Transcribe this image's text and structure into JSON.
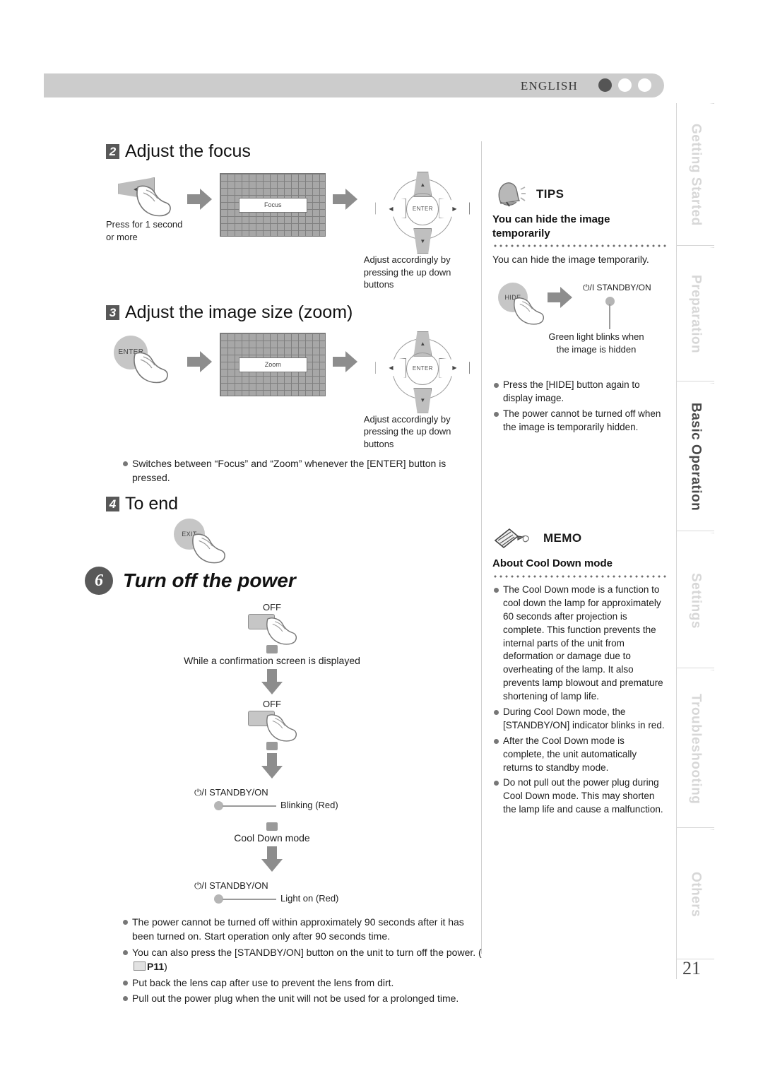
{
  "header": {
    "language": "ENGLISH",
    "dots": [
      "filled",
      "empty",
      "empty"
    ]
  },
  "sidebar": {
    "tabs": [
      {
        "label": "Getting Started",
        "active": false
      },
      {
        "label": "Preparation",
        "active": false
      },
      {
        "label": "Basic Operation",
        "active": true
      },
      {
        "label": "Settings",
        "active": false
      },
      {
        "label": "Troubleshooting",
        "active": false
      },
      {
        "label": "Others",
        "active": false
      }
    ],
    "page_number": "21"
  },
  "left": {
    "step2": {
      "number": "2",
      "title": "Adjust the focus",
      "press_caption_line1": "Press for 1 second",
      "press_caption_line2": "or more",
      "osd_label": "Focus",
      "dpad": {
        "center": "ENTER",
        "up": "▲",
        "down": "▼",
        "left": "◀",
        "right": "▶"
      },
      "adjust_caption_line1": "Adjust accordingly by",
      "adjust_caption_line2": "pressing the up down buttons"
    },
    "step3": {
      "number": "3",
      "title": "Adjust the image size (zoom)",
      "enter_key": "ENTER",
      "osd_label": "Zoom",
      "adjust_caption_line1": "Adjust accordingly by",
      "adjust_caption_line2": "pressing the up down buttons"
    },
    "switch_note": "Switches between “Focus” and “Zoom” whenever the [ENTER] button is pressed.",
    "step4": {
      "number": "4",
      "title": "To end",
      "exit_key": "EXIT"
    },
    "step6": {
      "number": "6",
      "title": "Turn off the power",
      "flow": {
        "off_label_1": "OFF",
        "confirm_text": "While a confirmation screen is displayed",
        "off_label_2": "OFF",
        "standby_label_1": "⏻/I  STANDBY/ON",
        "blinking_red": "Blinking (Red)",
        "cool_down_text": "Cool Down mode",
        "standby_label_2": "⏻/I  STANDBY/ON",
        "light_on_red": "Light on (Red)"
      },
      "bullets": [
        "The power cannot be turned off within approximately 90 seconds after it has been turned on. Start operation only after 90 seconds time.",
        "You can also press the [STANDBY/ON] button on the unit to turn off the power. (\u0001 P11)",
        "Put back the lens cap after use to prevent the lens from dirt.",
        "Pull out the power plug when the unit will not be used for a prolonged time."
      ],
      "bullet2_prefix": "You can also press the [STANDBY/ON] button on the unit to turn off the",
      "bullet2_suffix": "power. (",
      "bullet2_ref": "P11",
      "bullet2_end": ")"
    }
  },
  "right": {
    "tips": {
      "icon": "bell-icon",
      "title": "TIPS",
      "subtitle": "You can hide the image temporarily",
      "body": "You can hide the image temporarily.",
      "hide_key": "HIDE",
      "standby_label": "⏻/I  STANDBY/ON",
      "indicator_caption_line1": "Green light blinks when",
      "indicator_caption_line2": "the image is hidden",
      "bullets": [
        "Press the [HIDE] button again to display image.",
        "The power cannot be turned off when the image is temporarily hidden."
      ]
    },
    "memo": {
      "icon": "pencil-icon",
      "title": "MEMO",
      "subtitle": "About Cool Down mode",
      "bullets": [
        "The Cool Down mode is a function to cool down the lamp for approximately 60 seconds after projection is complete. This function prevents the internal parts of the unit from deformation or damage due to overheating of the lamp. It also prevents lamp blowout and premature shortening of lamp life.",
        "During Cool Down mode, the [STANDBY/ON] indicator blinks in red.",
        "After the Cool Down mode is complete, the unit automatically returns to standby mode.",
        "Do not pull out the power plug during Cool Down mode. This may shorten the lamp life and cause a malfunction."
      ]
    }
  },
  "colors": {
    "header_bar": "#cccccc",
    "accent_gray": "#8d8d8d",
    "key_gray": "#c6c6c6",
    "tab_inactive": "#d7d7d7",
    "tab_active": "#4a4a4a"
  }
}
